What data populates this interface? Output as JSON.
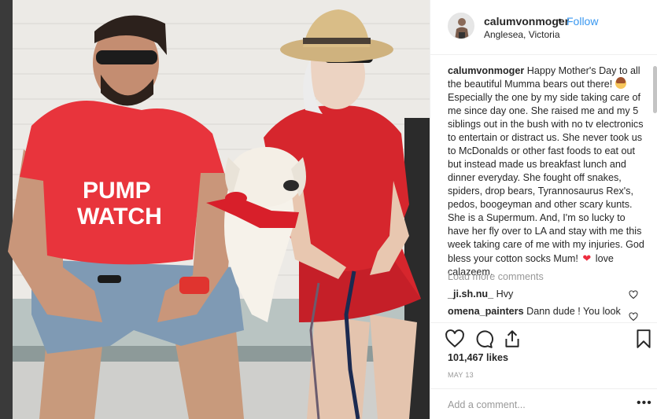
{
  "post": {
    "username": "calumvonmoger",
    "separator": "•",
    "follow_label": "Follow",
    "location": "Anglesea, Victoria",
    "photo": {
      "shirt_text_line1": "PUMP",
      "shirt_text_line2": "WATCH"
    },
    "caption": {
      "username": "calumvonmoger",
      "part1": "Happy Mother's Day to all the beautiful Mumma bears out there!",
      "emoji1_icon": "woman-emoji-icon",
      "part2": "Especially the one by my side taking care of me since day one. She raised me and my 5 siblings out in the bush with no tv electronics to entertain or distract us. She never took us to McDonalds or other fast foods to eat out but instead made us breakfast lunch and dinner everyday. She fought off snakes, spiders, drop bears, Tyrannosaurus Rex's, pedos, boogeyman and other scary kunts. She is a Supermum. And, I'm so lucky to have her fly over to LA and stay with me this week taking care of me with my injuries. God bless your cotton socks Mum!",
      "emoji2": "❤",
      "part3": "love calazeem."
    },
    "load_more_label": "Load more comments",
    "comments": [
      {
        "username": "_ji.sh.nu_",
        "text": "Hvy"
      },
      {
        "username": "omena_painters",
        "text": "Dann dude ! You look"
      }
    ],
    "likes": "101,467 likes",
    "date": "MAY 13",
    "add_comment_placeholder": "Add a comment...",
    "more_options": "•••",
    "colors": {
      "link_blue": "#3897f0",
      "muted_gray": "#999999",
      "border": "#efefef",
      "heart_red": "#ed2d3f"
    }
  }
}
